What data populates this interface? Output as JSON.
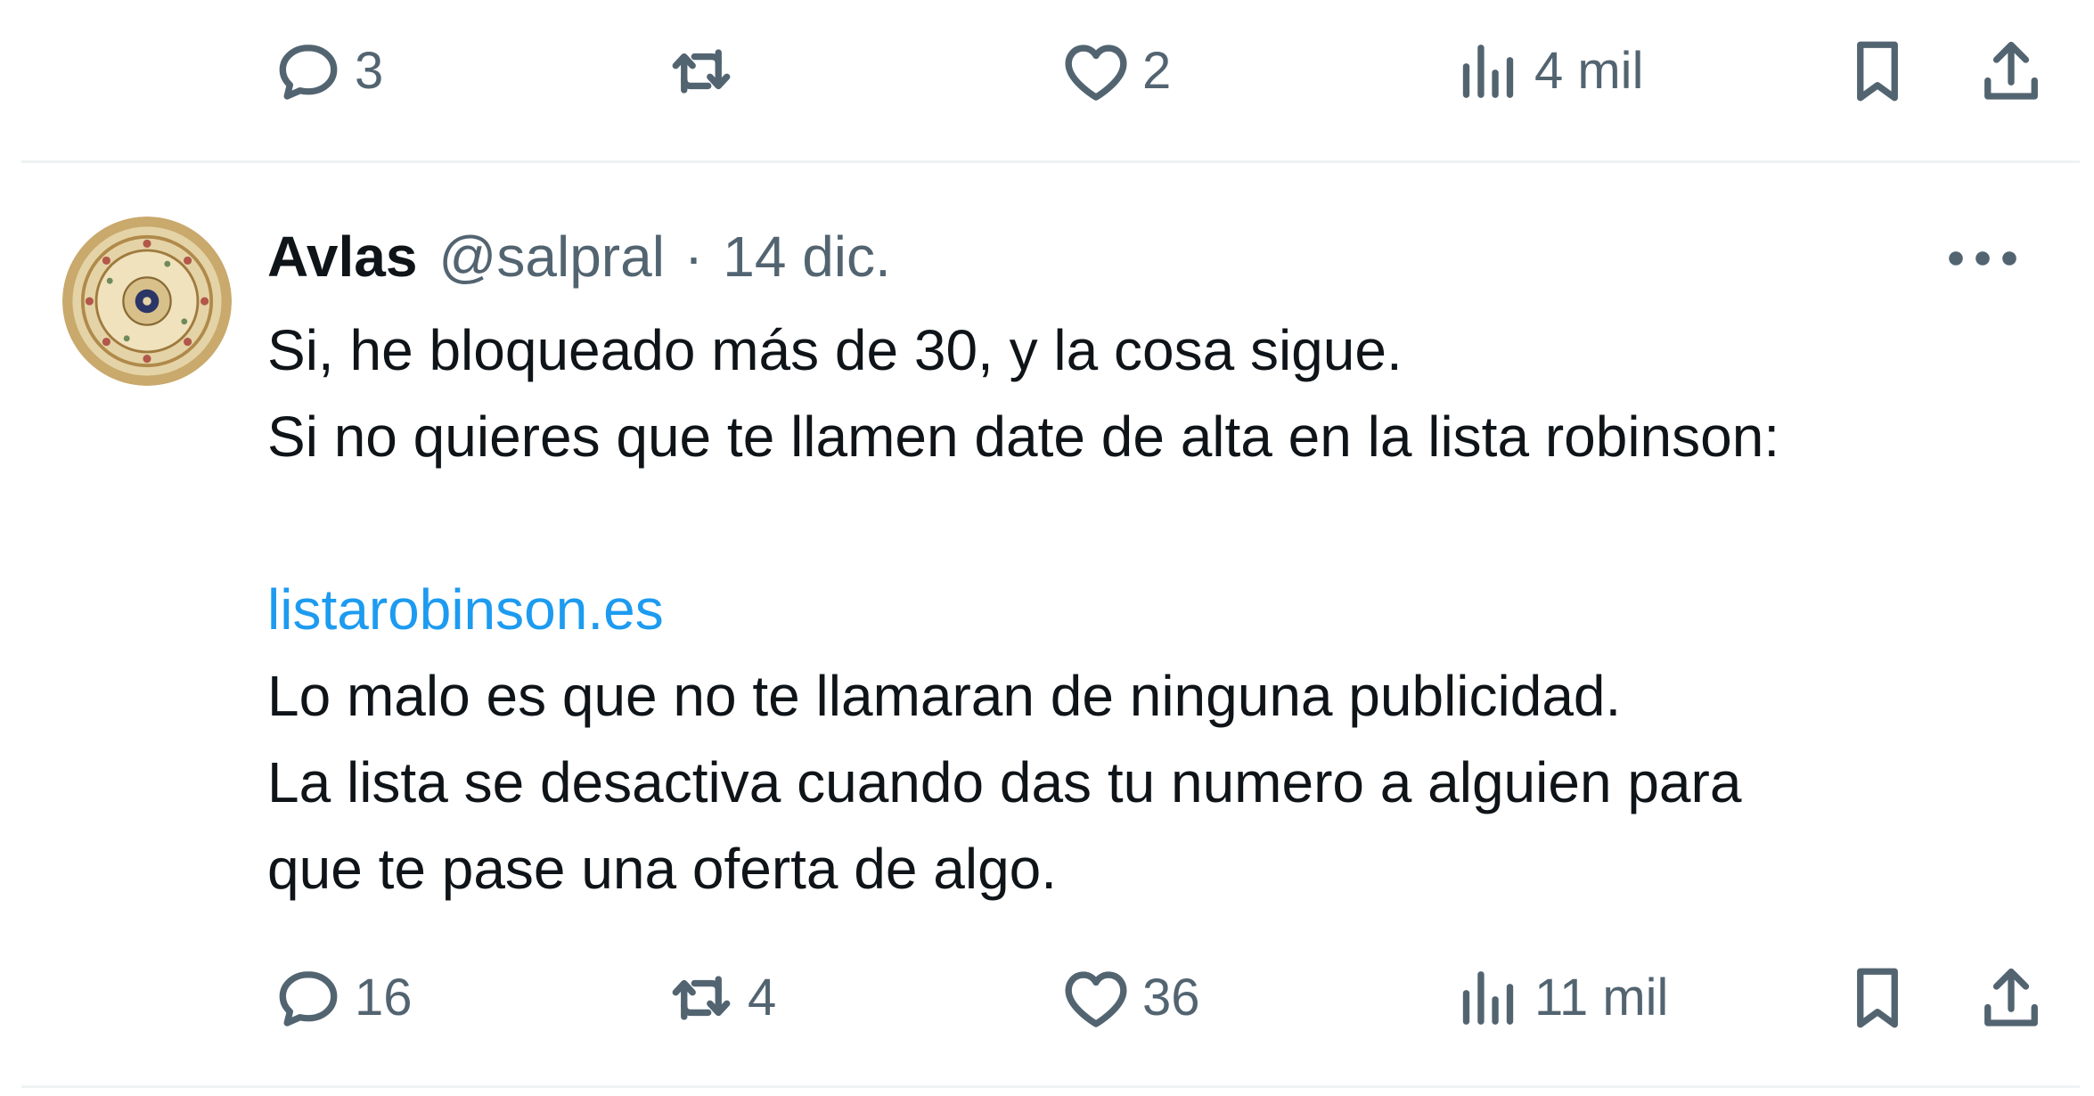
{
  "previous_tweet": {
    "actions": {
      "replies": "3",
      "retweets": "",
      "likes": "2",
      "views": "4 mil"
    }
  },
  "tweet": {
    "author": {
      "display_name": "Avlas",
      "handle": "@salpral",
      "separator": "·",
      "date": "14 dic."
    },
    "lines": [
      "Si, he bloqueado más de 30, y la cosa sigue.",
      "Si no quieres que te llamen date de alta en la lista robinson:",
      "",
      "listarobinson.es",
      "Lo malo es que no te llamaran de ninguna publicidad.",
      "La lista se desactiva cuando das tu numero a alguien para",
      "que te pase una oferta de algo."
    ],
    "actions": {
      "replies": "16",
      "retweets": "4",
      "likes": "36",
      "views": "11 mil"
    }
  },
  "icons": {
    "reply": "reply-icon",
    "retweet": "retweet-icon",
    "like": "heart-icon",
    "views": "views-icon",
    "bookmark": "bookmark-icon",
    "share": "share-icon",
    "more": "more-icon"
  },
  "colors": {
    "text": "#0f1419",
    "secondary": "#536471",
    "link": "#1d9bf0",
    "divider": "#eff3f4"
  }
}
